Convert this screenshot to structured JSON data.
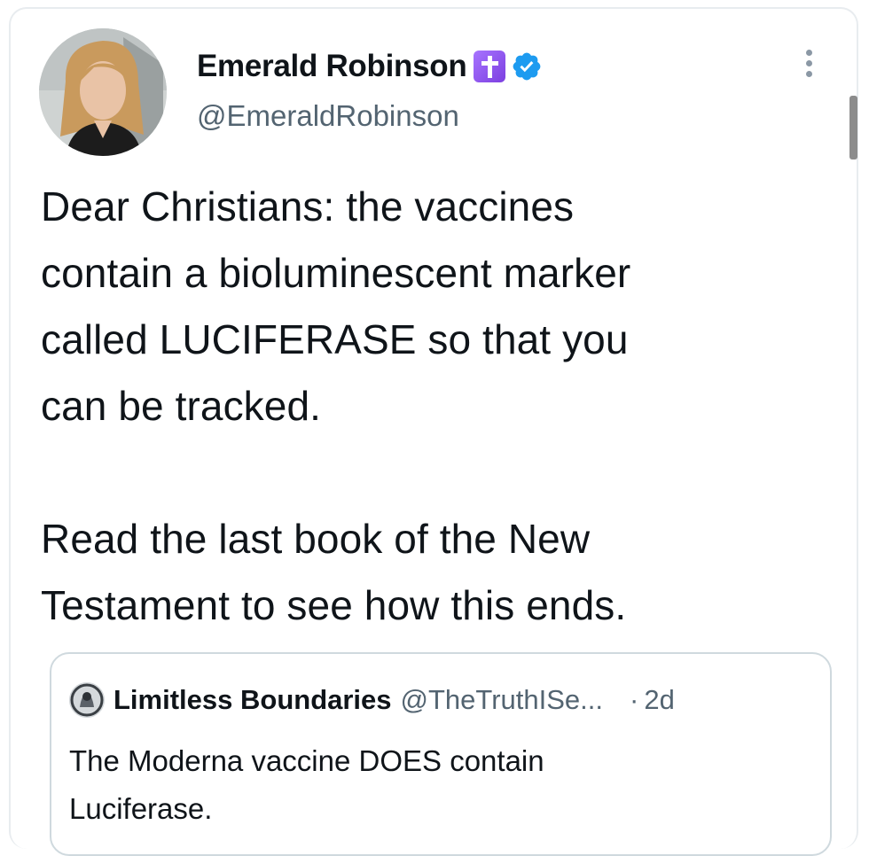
{
  "tweet": {
    "author": {
      "display_name": "Emerald Robinson",
      "handle": "@EmeraldRobinson",
      "name_emoji": "latin-cross-emoji",
      "verified": true,
      "verified_color": "#1d9bf0"
    },
    "text_lines": [
      "Dear Christians: the vaccines",
      "contain a bioluminescent marker",
      "called LUCIFERASE so that you",
      "can be tracked.",
      "Read the last book of the New",
      "Testament to see how this ends."
    ],
    "quoted_tweet": {
      "display_name": "Limitless Boundaries",
      "handle": "@TheTruthISe...",
      "separator": "·",
      "time": "2d",
      "text_lines": [
        "The Moderna vaccine DOES contain",
        "Luciferase."
      ]
    }
  },
  "colors": {
    "text_primary": "#0f1419",
    "text_secondary": "#536471",
    "border": "#cfd9de",
    "cross_emoji_bg": "#8e53f0"
  },
  "icons": {
    "more": "more-options-icon",
    "verified": "verified-badge-icon"
  }
}
